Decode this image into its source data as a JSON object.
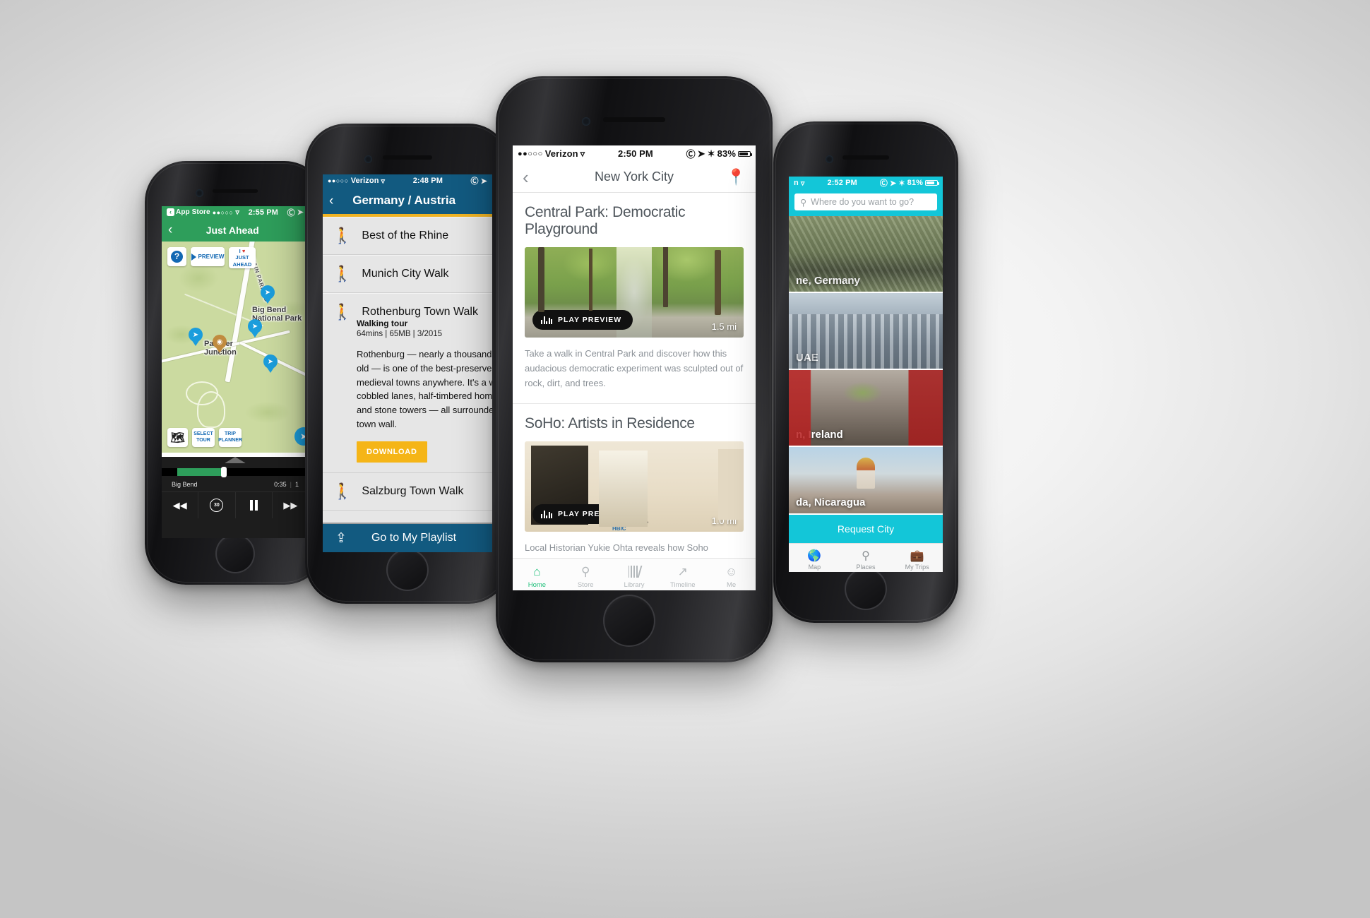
{
  "phone1": {
    "name": "just-ahead-map-phone",
    "status": {
      "back_app": "App Store",
      "carrier_dots": "●●○○○",
      "time": "2:55 PM"
    },
    "nav": {
      "back": "‹",
      "title": "Just Ahead"
    },
    "map": {
      "buttons_top": [
        {
          "name": "help-button",
          "label": "?"
        },
        {
          "name": "preview-button",
          "label": "PREVIEW"
        },
        {
          "name": "i-love-just-ahead-button",
          "line1": "I",
          "heart": "♥",
          "line2": "JUST",
          "line3": "AHEAD"
        }
      ],
      "buttons_bottom": [
        {
          "name": "map-view-button",
          "label": "🗺"
        },
        {
          "name": "select-tour-button",
          "line1": "SELECT",
          "line2": "TOUR"
        },
        {
          "name": "trip-planner-button",
          "line1": "TRIP",
          "line2": "PLANNER"
        }
      ],
      "labels": {
        "park": "Big Bend\nNational Park",
        "junction": "Panther\nJunction",
        "road": "MAIN PARK RD"
      }
    },
    "player": {
      "track": "Big Bend",
      "elapsed": "0:35",
      "remaining": "1",
      "controls": [
        "rewind",
        "back-30",
        "pause",
        "forward"
      ]
    }
  },
  "phone2": {
    "name": "germany-austria-tour-list-phone",
    "status": {
      "carrier": "Verizon",
      "carrier_dots": "●●○○○",
      "time": "2:48 PM"
    },
    "nav": {
      "back": "‹",
      "title": "Germany / Austria"
    },
    "tours": [
      {
        "name": "Best of the Rhine",
        "expanded": false
      },
      {
        "name": "Munich City Walk",
        "expanded": false
      },
      {
        "name": "Rothenburg Town Walk",
        "expanded": true,
        "subtitle": "Walking tour",
        "stats": "64mins | 65MB | 3/2015",
        "description": [
          "Rothenburg — nearly a thousand years",
          "old — is one of the best-preserved",
          "medieval towns anywhere. It's a warren of",
          "cobbled lanes, half-timbered homes,",
          "and stone towers — all surrounded by a",
          "town wall."
        ],
        "download_label": "DOWNLOAD"
      },
      {
        "name": "Salzburg Town Walk",
        "expanded": false
      }
    ],
    "bottom_bar": {
      "label": "Go to My Playlist",
      "icon": "share-icon"
    },
    "colors": {
      "navbar": "#125a80",
      "accent": "#f0b323",
      "download": "#f5b517"
    }
  },
  "phone3": {
    "name": "new-york-city-tours-phone",
    "status": {
      "carrier": "Verizon",
      "carrier_dots": "●●○○○",
      "time": "2:50 PM",
      "battery": "83%"
    },
    "nav": {
      "back": "‹",
      "title": "New York City",
      "right_icon": "location-pin-icon"
    },
    "cards": [
      {
        "title": "Central Park: Democratic Playground",
        "play_label": "PLAY PREVIEW",
        "distance": "1.5 mi",
        "blurb": "Take a walk in Central Park and discover how this audacious democratic experiment was sculpted out of rock, dirt, and trees."
      },
      {
        "title": "SoHo: Artists in Residence",
        "play_label": "PLAY PREVIEW",
        "distance": "1.0 mi",
        "blurb": "Local Historian Yukie Ohta reveals how Soho transformed from a manufacturing hub, to a vibrant artist community, to the shopping district of today."
      }
    ],
    "tabs": [
      {
        "label": "Home",
        "icon": "home-icon",
        "active": true
      },
      {
        "label": "Store",
        "icon": "search-icon",
        "active": false
      },
      {
        "label": "Library",
        "icon": "library-icon",
        "active": false
      },
      {
        "label": "Timeline",
        "icon": "timeline-icon",
        "active": false
      },
      {
        "label": "Me",
        "icon": "smiley-face-icon",
        "active": false
      }
    ],
    "colors": {
      "accent": "#22c07c",
      "title": "#4f565c",
      "body": "#8c9298"
    }
  },
  "phone4": {
    "name": "city-browser-phone",
    "status": {
      "carrier": "n",
      "time": "2:52 PM",
      "battery": "81%"
    },
    "search": {
      "placeholder": "Where do you want to go?",
      "icon": "search-icon"
    },
    "cities": [
      {
        "label": "ne, Germany"
      },
      {
        "label": "UAE"
      },
      {
        "label": "n, Ireland"
      },
      {
        "label": "da, Nicaragua"
      }
    ],
    "request_button": "Request City",
    "tabs": [
      {
        "label": "Map",
        "icon": "globe-icon"
      },
      {
        "label": "Places",
        "icon": "location-pin-icon"
      },
      {
        "label": "My Trips",
        "icon": "suitcase-icon"
      }
    ],
    "colors": {
      "accent": "#13c6d8"
    }
  }
}
